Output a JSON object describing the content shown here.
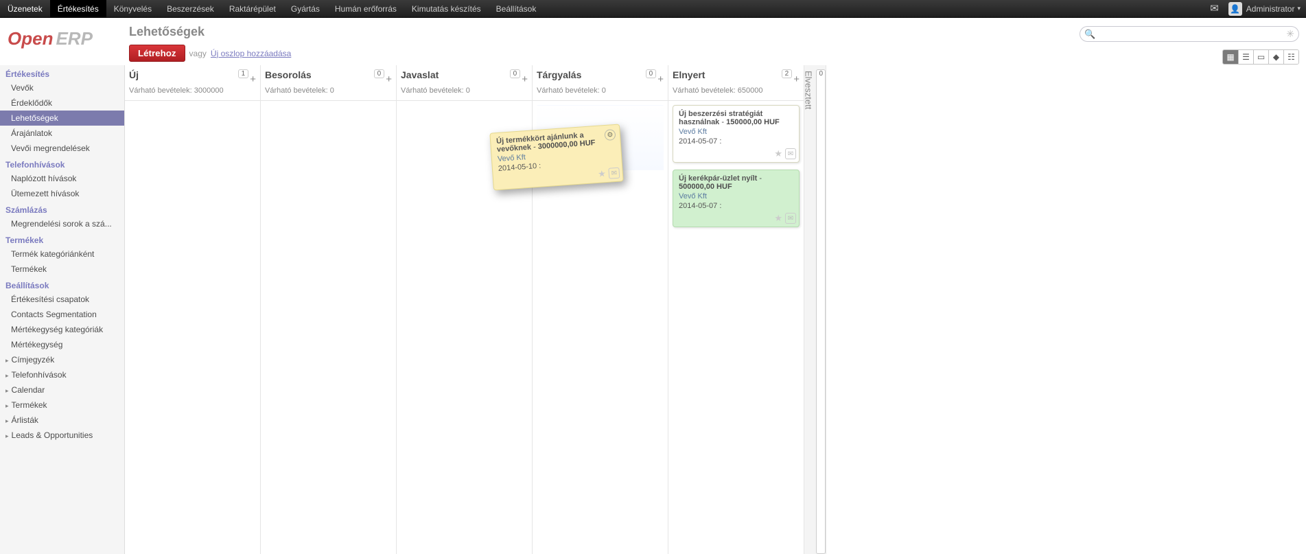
{
  "topnav": {
    "items": [
      "Üzenetek",
      "Értékesítés",
      "Könyvelés",
      "Beszerzések",
      "Raktárépület",
      "Gyártás",
      "Humán erőforrás",
      "Kimutatás készítés",
      "Beállítások"
    ],
    "active_index": 1,
    "user_name": "Administrator"
  },
  "page": {
    "title": "Lehetőségek",
    "create_label": "Létrehoz",
    "or_label": "vagy",
    "add_column_label": "Új oszlop hozzáadása"
  },
  "search": {
    "placeholder": ""
  },
  "sidebar": {
    "sections": [
      {
        "title": "Értékesítés",
        "items": [
          {
            "label": "Vevők"
          },
          {
            "label": "Érdeklődők"
          },
          {
            "label": "Lehetőségek",
            "active": true
          },
          {
            "label": "Árajánlatok"
          },
          {
            "label": "Vevői megrendelések"
          }
        ]
      },
      {
        "title": "Telefonhívások",
        "items": [
          {
            "label": "Naplózott hívások"
          },
          {
            "label": "Ütemezett hívások"
          }
        ]
      },
      {
        "title": "Számlázás",
        "items": [
          {
            "label": "Megrendelési sorok a szá..."
          }
        ]
      },
      {
        "title": "Termékek",
        "items": [
          {
            "label": "Termék kategóriánként"
          },
          {
            "label": "Termékek"
          }
        ]
      },
      {
        "title": "Beállítások",
        "items": [
          {
            "label": "Értékesítési csapatok"
          },
          {
            "label": "Contacts Segmentation"
          },
          {
            "label": "Mértékegység kategóriák"
          },
          {
            "label": "Mértékegység"
          },
          {
            "label": "Címjegyzék",
            "collapsible": true
          },
          {
            "label": "Telefonhívások",
            "collapsible": true
          },
          {
            "label": "Calendar",
            "collapsible": true
          },
          {
            "label": "Termékek",
            "collapsible": true
          },
          {
            "label": "Árlisták",
            "collapsible": true
          },
          {
            "label": "Leads & Opportunities",
            "collapsible": true
          }
        ]
      }
    ]
  },
  "kanban": {
    "revenue_label": "Várható bevételek:",
    "columns": [
      {
        "title": "Új",
        "count": "1",
        "revenue": "3000000"
      },
      {
        "title": "Besorolás",
        "count": "0",
        "revenue": "0"
      },
      {
        "title": "Javaslat",
        "count": "0",
        "revenue": "0"
      },
      {
        "title": "Tárgyalás",
        "count": "0",
        "revenue": "0",
        "dropzone": true
      },
      {
        "title": "Elnyert",
        "count": "2",
        "revenue": "650000"
      }
    ],
    "folded": {
      "title": "Elvesztett",
      "count": "0"
    },
    "dragging_card": {
      "title": "Új termékkört ajánlunk a vevőknek",
      "amount": "3000000,00 HUF",
      "company": "Vevő Kft",
      "date": "2014-05-10 :"
    },
    "won_cards": [
      {
        "title": "Új beszerzési stratégiát használnak",
        "amount": "150000,00 HUF",
        "company": "Vevő Kft",
        "date": "2014-05-07 :",
        "style": "white"
      },
      {
        "title": "Új kerékpár-üzlet nyílt",
        "amount": "500000,00 HUF",
        "company": "Vevő Kft",
        "date": "2014-05-07 :",
        "style": "green"
      }
    ]
  }
}
